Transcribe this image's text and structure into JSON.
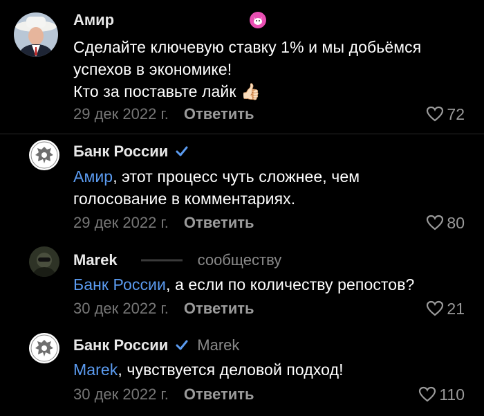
{
  "comments": [
    {
      "author": "Амир",
      "badge_icon": "cat-badge-icon",
      "text_line1": "Сделайте ключевую ставку 1% и мы добьёмся",
      "text_line2": "успехов в экономике!",
      "text_line3": "Кто за поставьте лайк",
      "emoji": "👍🏻",
      "date": "29 дек 2022 г.",
      "reply": "Ответить",
      "likes": "72"
    },
    {
      "author": "Банк России",
      "verified_icon": "checkmark-icon",
      "mention": "Амир",
      "text_rest": ", этот процесс чуть сложнее, чем",
      "text_line2": "голосование в комментариях.",
      "date": "29 дек 2022 г.",
      "reply": "Ответить",
      "likes": "80"
    },
    {
      "author": "Marek",
      "subtitle": "сообществу",
      "mention": "Банк России",
      "text_rest": ", а если по количеству репостов?",
      "date": "30 дек 2022 г.",
      "reply": "Ответить",
      "likes": "21"
    },
    {
      "author": "Банк России",
      "verified_icon": "checkmark-icon",
      "reply_to": "Marek",
      "mention": "Marek",
      "text_rest": ", чувствуется деловой подход!",
      "date": "30 дек 2022 г.",
      "reply": "Ответить",
      "likes": "110"
    }
  ],
  "colors": {
    "background": "#000000",
    "mention": "#5b9bf0",
    "verified": "#5b9bf0",
    "muted": "#777777"
  }
}
